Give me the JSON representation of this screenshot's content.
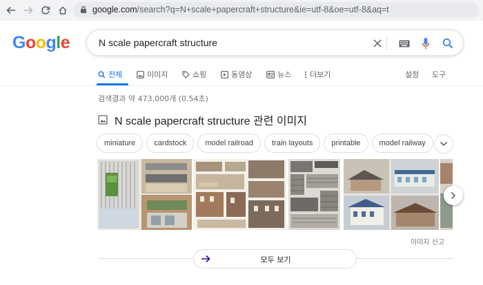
{
  "browser": {
    "url_host": "google.com",
    "url_rest": "/search?q=N+scale+papercraft+structure&ie=utf-8&oe=utf-8&aq=t"
  },
  "logo": {
    "letters": [
      "G",
      "o",
      "o",
      "g",
      "l",
      "e"
    ],
    "colors": [
      "#4285f4",
      "#ea4335",
      "#fbbc05",
      "#4285f4",
      "#34a853",
      "#ea4335"
    ]
  },
  "search": {
    "query": "N scale papercraft structure"
  },
  "tabs": [
    {
      "label": "전체",
      "icon": "search-icon"
    },
    {
      "label": "이미지",
      "icon": "image-icon"
    },
    {
      "label": "쇼핑",
      "icon": "tag-icon"
    },
    {
      "label": "동영상",
      "icon": "play-icon"
    },
    {
      "label": "뉴스",
      "icon": "news-icon"
    },
    {
      "label": "더보기",
      "icon": "more-vert-icon"
    }
  ],
  "tools": {
    "settings_label": "설정",
    "tools_label": "도구"
  },
  "results_count": "검색결과 약 473,000개 (0.54초)",
  "images_section": {
    "heading": "N scale papercraft structure 관련 이미지",
    "chips": [
      "miniature",
      "cardstock",
      "model railroad",
      "train layouts",
      "printable",
      "model railway"
    ],
    "report_label": "이미지 신고",
    "see_all_label": "모두 보기"
  },
  "colors": {
    "accent": "#1a73e8",
    "text": "#202124",
    "muted": "#70757a",
    "border": "#dadce0"
  }
}
